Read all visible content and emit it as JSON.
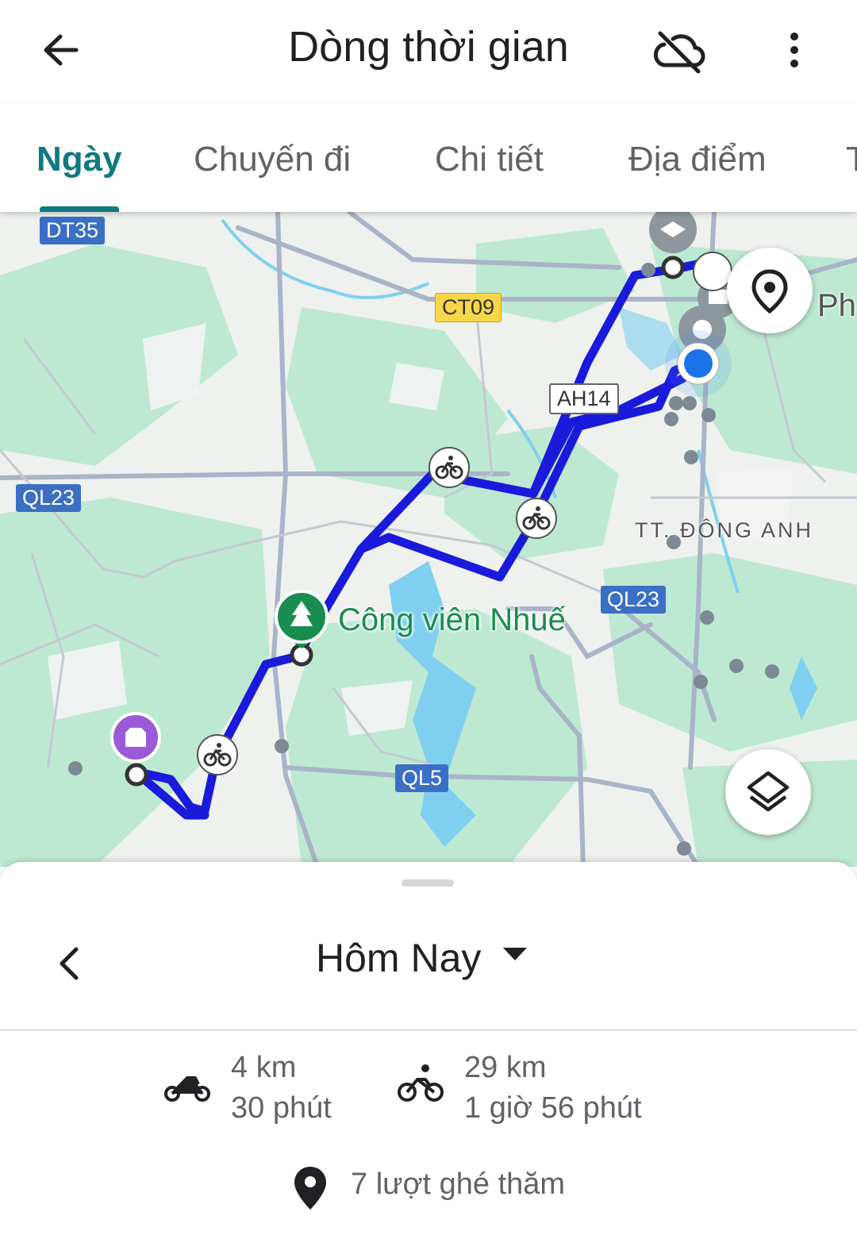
{
  "header": {
    "title": "Dòng thời gian",
    "back_icon": "arrow-back-icon",
    "cloud_icon": "cloud-off-icon",
    "more_icon": "more-vert-icon"
  },
  "tabs": [
    {
      "label": "Ngày",
      "active": true
    },
    {
      "label": "Chuyến đi",
      "active": false
    },
    {
      "label": "Chi tiết",
      "active": false
    },
    {
      "label": "Địa điểm",
      "active": false
    },
    {
      "label": "T",
      "active": false
    }
  ],
  "map": {
    "road_labels": {
      "dt35": "DT35",
      "ct09": "CT09",
      "ah14": "AH14",
      "ql23_left": "QL23",
      "ql23_right": "QL23",
      "ql5": "QL5"
    },
    "place_park": "Công viên Nhuế",
    "town": "TT. ĐÔNG ANH",
    "edge_text": "Ph",
    "route_color": "#1a1adb",
    "water_color": "#7fd0f0",
    "green_color": "#b9e8cf",
    "location_button_icon": "location-pin-icon",
    "layers_button_icon": "layers-icon"
  },
  "sheet": {
    "date_label": "Hôm Nay",
    "prev_icon": "chevron-left-icon",
    "dropdown_icon": "arrow-drop-down-icon",
    "stats": {
      "motorbike": {
        "distance": "4 km",
        "duration": "30 phút",
        "icon": "motorcycle-icon"
      },
      "bicycle": {
        "distance": "29 km",
        "duration": "1 giờ 56 phút",
        "icon": "bicycle-icon"
      }
    },
    "visits": "7 lượt ghé thăm",
    "visits_icon": "place-pin-icon"
  }
}
